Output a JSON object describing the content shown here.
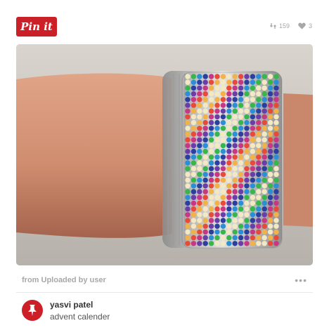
{
  "pin_button": {
    "label": "Pin it"
  },
  "stats": {
    "repins": "159",
    "likes": "3"
  },
  "image": {
    "alt": "Beaded safety pin bracelet on wrist"
  },
  "source": {
    "text": "from Uploaded by user",
    "more": "•••"
  },
  "pinner": {
    "name": "yasvi patel",
    "board": "advent calender"
  },
  "colors": {
    "brand": "#cb2027",
    "muted": "#a7a7a7"
  }
}
